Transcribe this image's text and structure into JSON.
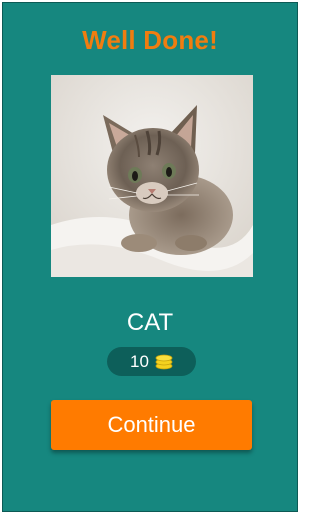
{
  "title": "Well Done!",
  "image": {
    "subject": "kitten"
  },
  "answer": "CAT",
  "coins": {
    "count": "10",
    "icon": "coin-stack-icon"
  },
  "continue_label": "Continue",
  "colors": {
    "background": "#16877f",
    "title": "#f07d10",
    "button": "#ff7b00",
    "pill": "#0d5f5a",
    "coin": "#f4d21f"
  }
}
